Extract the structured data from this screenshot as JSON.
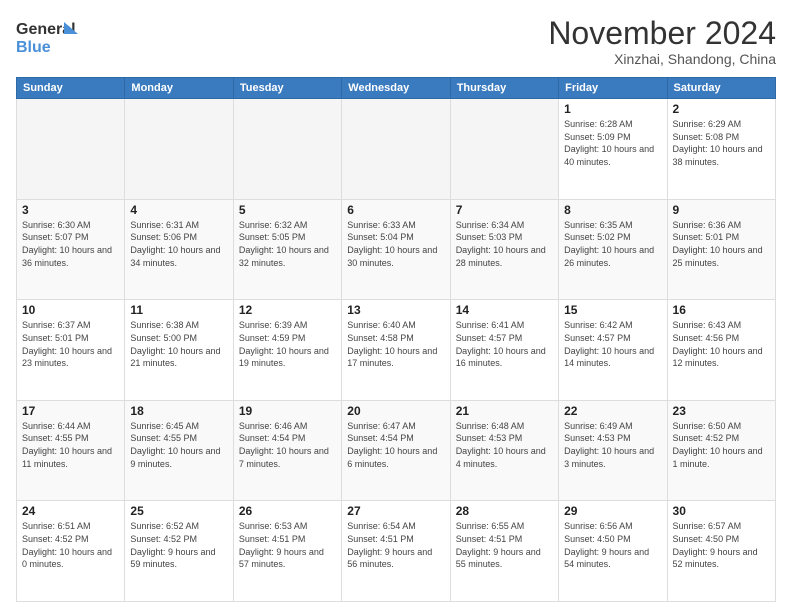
{
  "logo": {
    "line1": "General",
    "line2": "Blue"
  },
  "header": {
    "month": "November 2024",
    "location": "Xinzhai, Shandong, China"
  },
  "days_of_week": [
    "Sunday",
    "Monday",
    "Tuesday",
    "Wednesday",
    "Thursday",
    "Friday",
    "Saturday"
  ],
  "weeks": [
    [
      {
        "day": "",
        "info": ""
      },
      {
        "day": "",
        "info": ""
      },
      {
        "day": "",
        "info": ""
      },
      {
        "day": "",
        "info": ""
      },
      {
        "day": "",
        "info": ""
      },
      {
        "day": "1",
        "info": "Sunrise: 6:28 AM\nSunset: 5:09 PM\nDaylight: 10 hours and 40 minutes."
      },
      {
        "day": "2",
        "info": "Sunrise: 6:29 AM\nSunset: 5:08 PM\nDaylight: 10 hours and 38 minutes."
      }
    ],
    [
      {
        "day": "3",
        "info": "Sunrise: 6:30 AM\nSunset: 5:07 PM\nDaylight: 10 hours and 36 minutes."
      },
      {
        "day": "4",
        "info": "Sunrise: 6:31 AM\nSunset: 5:06 PM\nDaylight: 10 hours and 34 minutes."
      },
      {
        "day": "5",
        "info": "Sunrise: 6:32 AM\nSunset: 5:05 PM\nDaylight: 10 hours and 32 minutes."
      },
      {
        "day": "6",
        "info": "Sunrise: 6:33 AM\nSunset: 5:04 PM\nDaylight: 10 hours and 30 minutes."
      },
      {
        "day": "7",
        "info": "Sunrise: 6:34 AM\nSunset: 5:03 PM\nDaylight: 10 hours and 28 minutes."
      },
      {
        "day": "8",
        "info": "Sunrise: 6:35 AM\nSunset: 5:02 PM\nDaylight: 10 hours and 26 minutes."
      },
      {
        "day": "9",
        "info": "Sunrise: 6:36 AM\nSunset: 5:01 PM\nDaylight: 10 hours and 25 minutes."
      }
    ],
    [
      {
        "day": "10",
        "info": "Sunrise: 6:37 AM\nSunset: 5:01 PM\nDaylight: 10 hours and 23 minutes."
      },
      {
        "day": "11",
        "info": "Sunrise: 6:38 AM\nSunset: 5:00 PM\nDaylight: 10 hours and 21 minutes."
      },
      {
        "day": "12",
        "info": "Sunrise: 6:39 AM\nSunset: 4:59 PM\nDaylight: 10 hours and 19 minutes."
      },
      {
        "day": "13",
        "info": "Sunrise: 6:40 AM\nSunset: 4:58 PM\nDaylight: 10 hours and 17 minutes."
      },
      {
        "day": "14",
        "info": "Sunrise: 6:41 AM\nSunset: 4:57 PM\nDaylight: 10 hours and 16 minutes."
      },
      {
        "day": "15",
        "info": "Sunrise: 6:42 AM\nSunset: 4:57 PM\nDaylight: 10 hours and 14 minutes."
      },
      {
        "day": "16",
        "info": "Sunrise: 6:43 AM\nSunset: 4:56 PM\nDaylight: 10 hours and 12 minutes."
      }
    ],
    [
      {
        "day": "17",
        "info": "Sunrise: 6:44 AM\nSunset: 4:55 PM\nDaylight: 10 hours and 11 minutes."
      },
      {
        "day": "18",
        "info": "Sunrise: 6:45 AM\nSunset: 4:55 PM\nDaylight: 10 hours and 9 minutes."
      },
      {
        "day": "19",
        "info": "Sunrise: 6:46 AM\nSunset: 4:54 PM\nDaylight: 10 hours and 7 minutes."
      },
      {
        "day": "20",
        "info": "Sunrise: 6:47 AM\nSunset: 4:54 PM\nDaylight: 10 hours and 6 minutes."
      },
      {
        "day": "21",
        "info": "Sunrise: 6:48 AM\nSunset: 4:53 PM\nDaylight: 10 hours and 4 minutes."
      },
      {
        "day": "22",
        "info": "Sunrise: 6:49 AM\nSunset: 4:53 PM\nDaylight: 10 hours and 3 minutes."
      },
      {
        "day": "23",
        "info": "Sunrise: 6:50 AM\nSunset: 4:52 PM\nDaylight: 10 hours and 1 minute."
      }
    ],
    [
      {
        "day": "24",
        "info": "Sunrise: 6:51 AM\nSunset: 4:52 PM\nDaylight: 10 hours and 0 minutes."
      },
      {
        "day": "25",
        "info": "Sunrise: 6:52 AM\nSunset: 4:52 PM\nDaylight: 9 hours and 59 minutes."
      },
      {
        "day": "26",
        "info": "Sunrise: 6:53 AM\nSunset: 4:51 PM\nDaylight: 9 hours and 57 minutes."
      },
      {
        "day": "27",
        "info": "Sunrise: 6:54 AM\nSunset: 4:51 PM\nDaylight: 9 hours and 56 minutes."
      },
      {
        "day": "28",
        "info": "Sunrise: 6:55 AM\nSunset: 4:51 PM\nDaylight: 9 hours and 55 minutes."
      },
      {
        "day": "29",
        "info": "Sunrise: 6:56 AM\nSunset: 4:50 PM\nDaylight: 9 hours and 54 minutes."
      },
      {
        "day": "30",
        "info": "Sunrise: 6:57 AM\nSunset: 4:50 PM\nDaylight: 9 hours and 52 minutes."
      }
    ]
  ]
}
